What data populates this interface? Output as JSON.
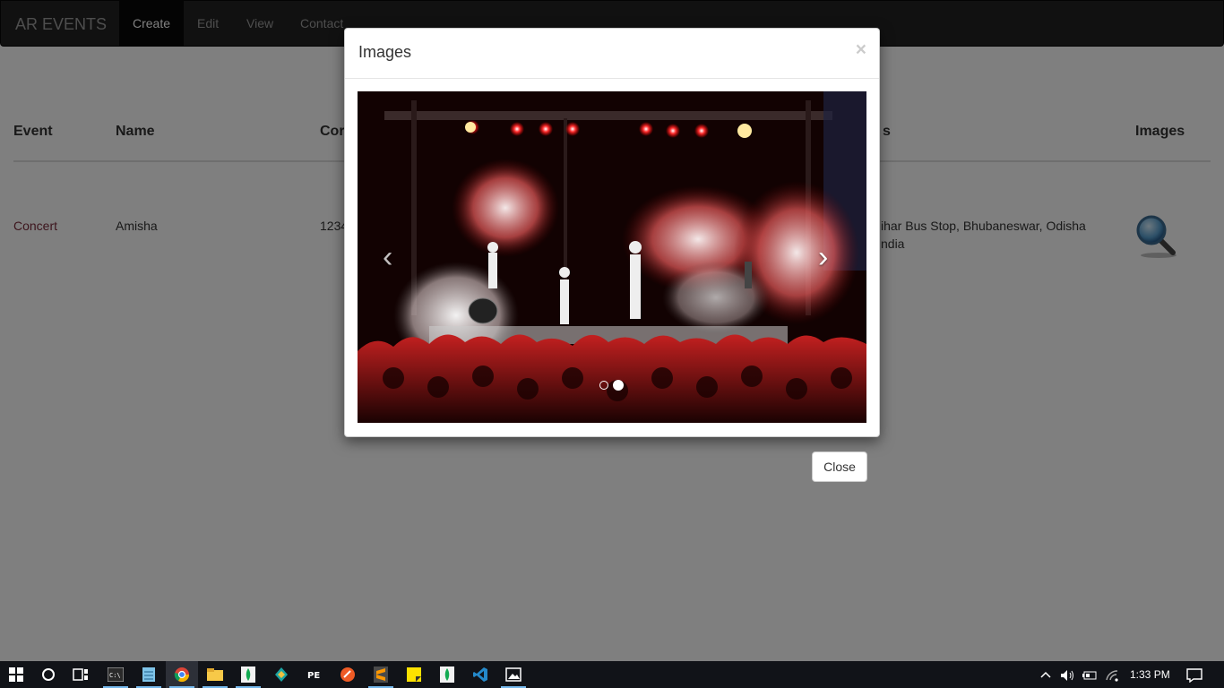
{
  "navbar": {
    "brand": "AR EVENTS",
    "items": [
      {
        "label": "Create",
        "active": true
      },
      {
        "label": "Edit",
        "active": false
      },
      {
        "label": "View",
        "active": false
      },
      {
        "label": "Contact",
        "active": false
      }
    ]
  },
  "table": {
    "headers": {
      "event": "Event",
      "name": "Name",
      "contact": "Cor",
      "address": "s",
      "images": "Images"
    },
    "row": {
      "event": "Concert",
      "name": "Amisha",
      "contact": "1234",
      "address_line1": "ihar Bus Stop, Bhubaneswar, Odisha",
      "address_line2": "ndia"
    }
  },
  "modal": {
    "title": "Images",
    "close_x": "×",
    "prev": "‹",
    "next": "›",
    "slide_count": 2,
    "active_slide": 2
  },
  "close_button": "Close",
  "taskbar": {
    "time": "1:33 PM",
    "pinned": [
      "windows-start",
      "cortana-search",
      "task-view",
      "cmd",
      "notepad",
      "chrome",
      "file-explorer",
      "mongodb-compass",
      "git-kraken",
      "pe-explorer",
      "postman",
      "sublime-text",
      "sticky-notes",
      "mongodb",
      "vscode",
      "photos"
    ]
  },
  "colors": {
    "navbar_bg": "#222222",
    "link": "#7a2a3a",
    "taskbar_bg": "#111318",
    "accent": "#76b9ed"
  }
}
